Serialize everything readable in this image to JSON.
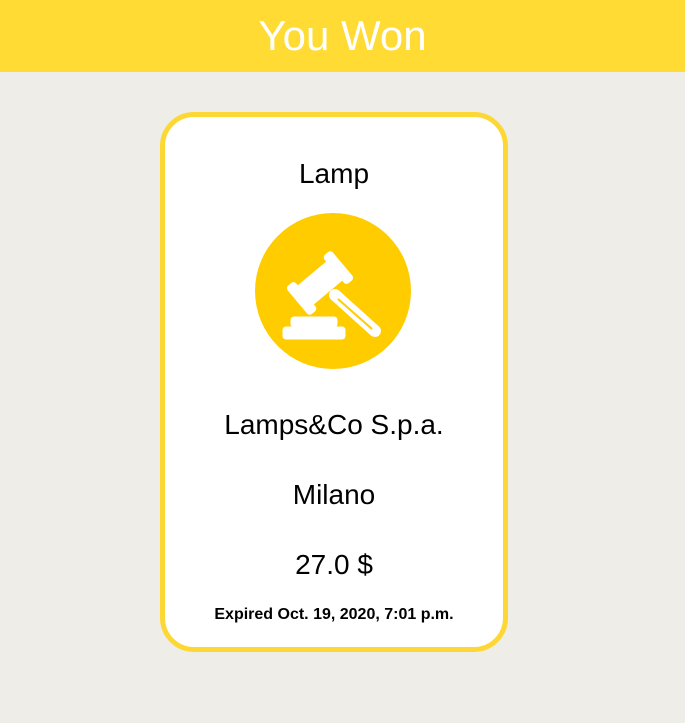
{
  "header": {
    "title": "You Won"
  },
  "card": {
    "item_name": "Lamp",
    "icon": "auction-gavel-icon",
    "seller": "Lamps&Co S.p.a.",
    "city": "Milano",
    "price": "27.0 $",
    "expiry": "Expired Oct. 19, 2020, 7:01 p.m."
  },
  "colors": {
    "header_bg": "#ffdb33",
    "page_bg": "#efede8",
    "card_border": "#fdd835",
    "icon_circle": "#ffcc00"
  }
}
